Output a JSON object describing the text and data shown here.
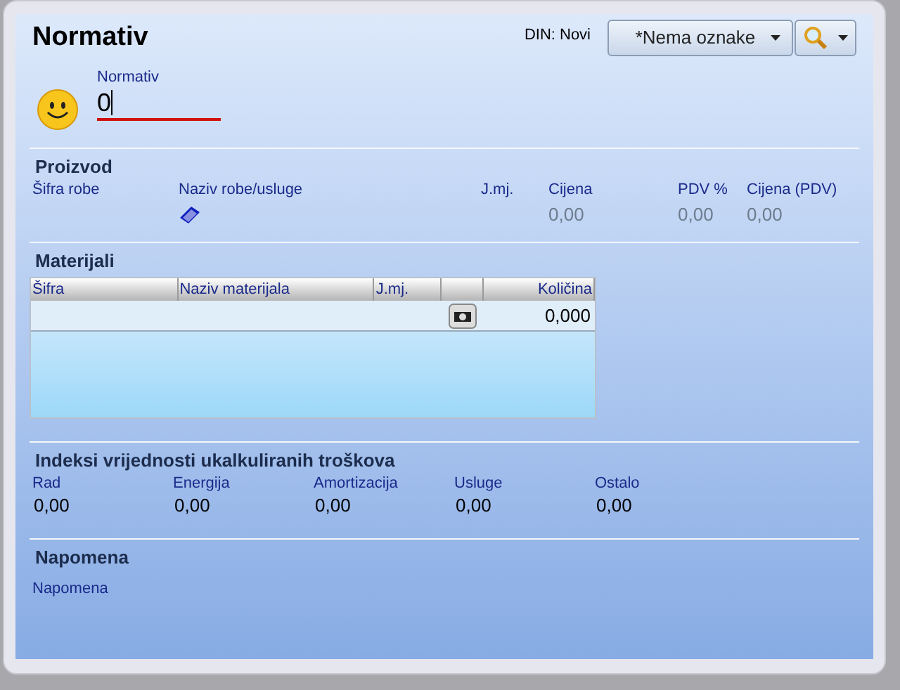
{
  "title": "Normativ",
  "din": "DIN: Novi",
  "tag_dropdown": {
    "value": "*Nema oznake"
  },
  "normativ": {
    "label": "Normativ",
    "value": "0"
  },
  "proizvod": {
    "title": "Proizvod",
    "columns": [
      {
        "label": "Šifra robe",
        "kind": "text"
      },
      {
        "label": "Naziv robe/usluge",
        "kind": "lookup"
      },
      {
        "label": "J.mj.",
        "kind": "text"
      },
      {
        "label": "Cijena",
        "value": "0,00",
        "kind": "text"
      },
      {
        "label": "PDV %",
        "value": "0,00",
        "kind": "text"
      },
      {
        "label": "Cijena (PDV)",
        "value": "0,00",
        "kind": "text"
      }
    ]
  },
  "materijali": {
    "title": "Materijali",
    "columns": [
      {
        "kind": "text",
        "label": "Šifra"
      },
      {
        "kind": "text",
        "label": "Naziv materijala"
      },
      {
        "kind": "text",
        "label": "J.mj."
      },
      {
        "kind": "action"
      },
      {
        "kind": "number",
        "label": "Količina"
      }
    ],
    "rows": [
      {
        "kolicina": "0,000"
      }
    ]
  },
  "indeksi": {
    "title": "Indeksi vrijednosti ukalkuliranih troškova",
    "items": [
      {
        "label": "Rad",
        "value": "0,00"
      },
      {
        "label": "Energija",
        "value": "0,00"
      },
      {
        "label": "Amortizacija",
        "value": "0,00"
      },
      {
        "label": "Usluge",
        "value": "0,00"
      },
      {
        "label": "Ostalo",
        "value": "0,00"
      }
    ]
  },
  "napomena": {
    "title": "Napomena",
    "label": "Napomena"
  }
}
